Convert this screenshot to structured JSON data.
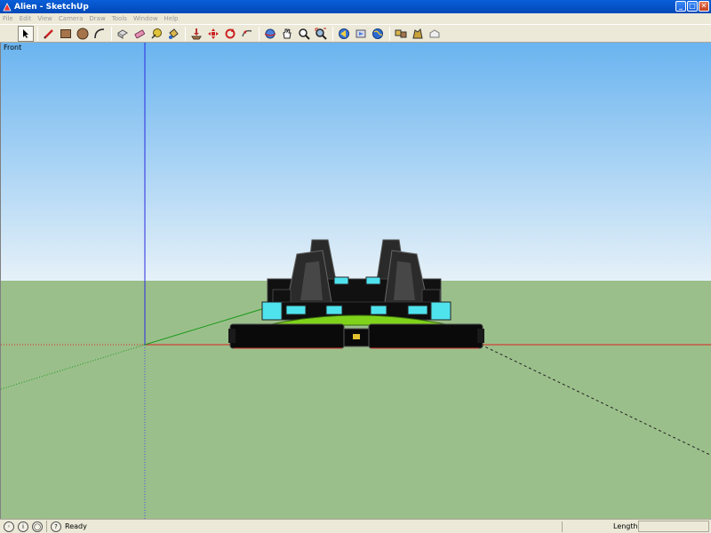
{
  "window": {
    "title": "Alien - SketchUp"
  },
  "menu": {
    "items": [
      "File",
      "Edit",
      "View",
      "Camera",
      "Draw",
      "Tools",
      "Window",
      "Help"
    ]
  },
  "toolbar": {
    "tools": [
      "select-icon",
      "pencil-icon",
      "rectangle-icon",
      "circle-icon",
      "arc-icon",
      "push-pull-icon",
      "eraser-icon",
      "tape-measure-icon",
      "paint-bucket-icon",
      "push-pull-down-icon",
      "move-icon",
      "rotate-icon",
      "follow-me-icon",
      "orbit-icon",
      "pan-icon",
      "zoom-icon",
      "zoom-extents-icon",
      "previous-view-icon",
      "next-view-icon",
      "geo-icon",
      "components-icon",
      "warehouse-icon",
      "share-icon"
    ]
  },
  "viewport": {
    "view_label": "Front",
    "sky_color": "#6fb5ee",
    "ground_color": "#9bbf8b"
  },
  "statusbar": {
    "status_text": "Ready",
    "measure_label": "Length",
    "measure_value": ""
  }
}
